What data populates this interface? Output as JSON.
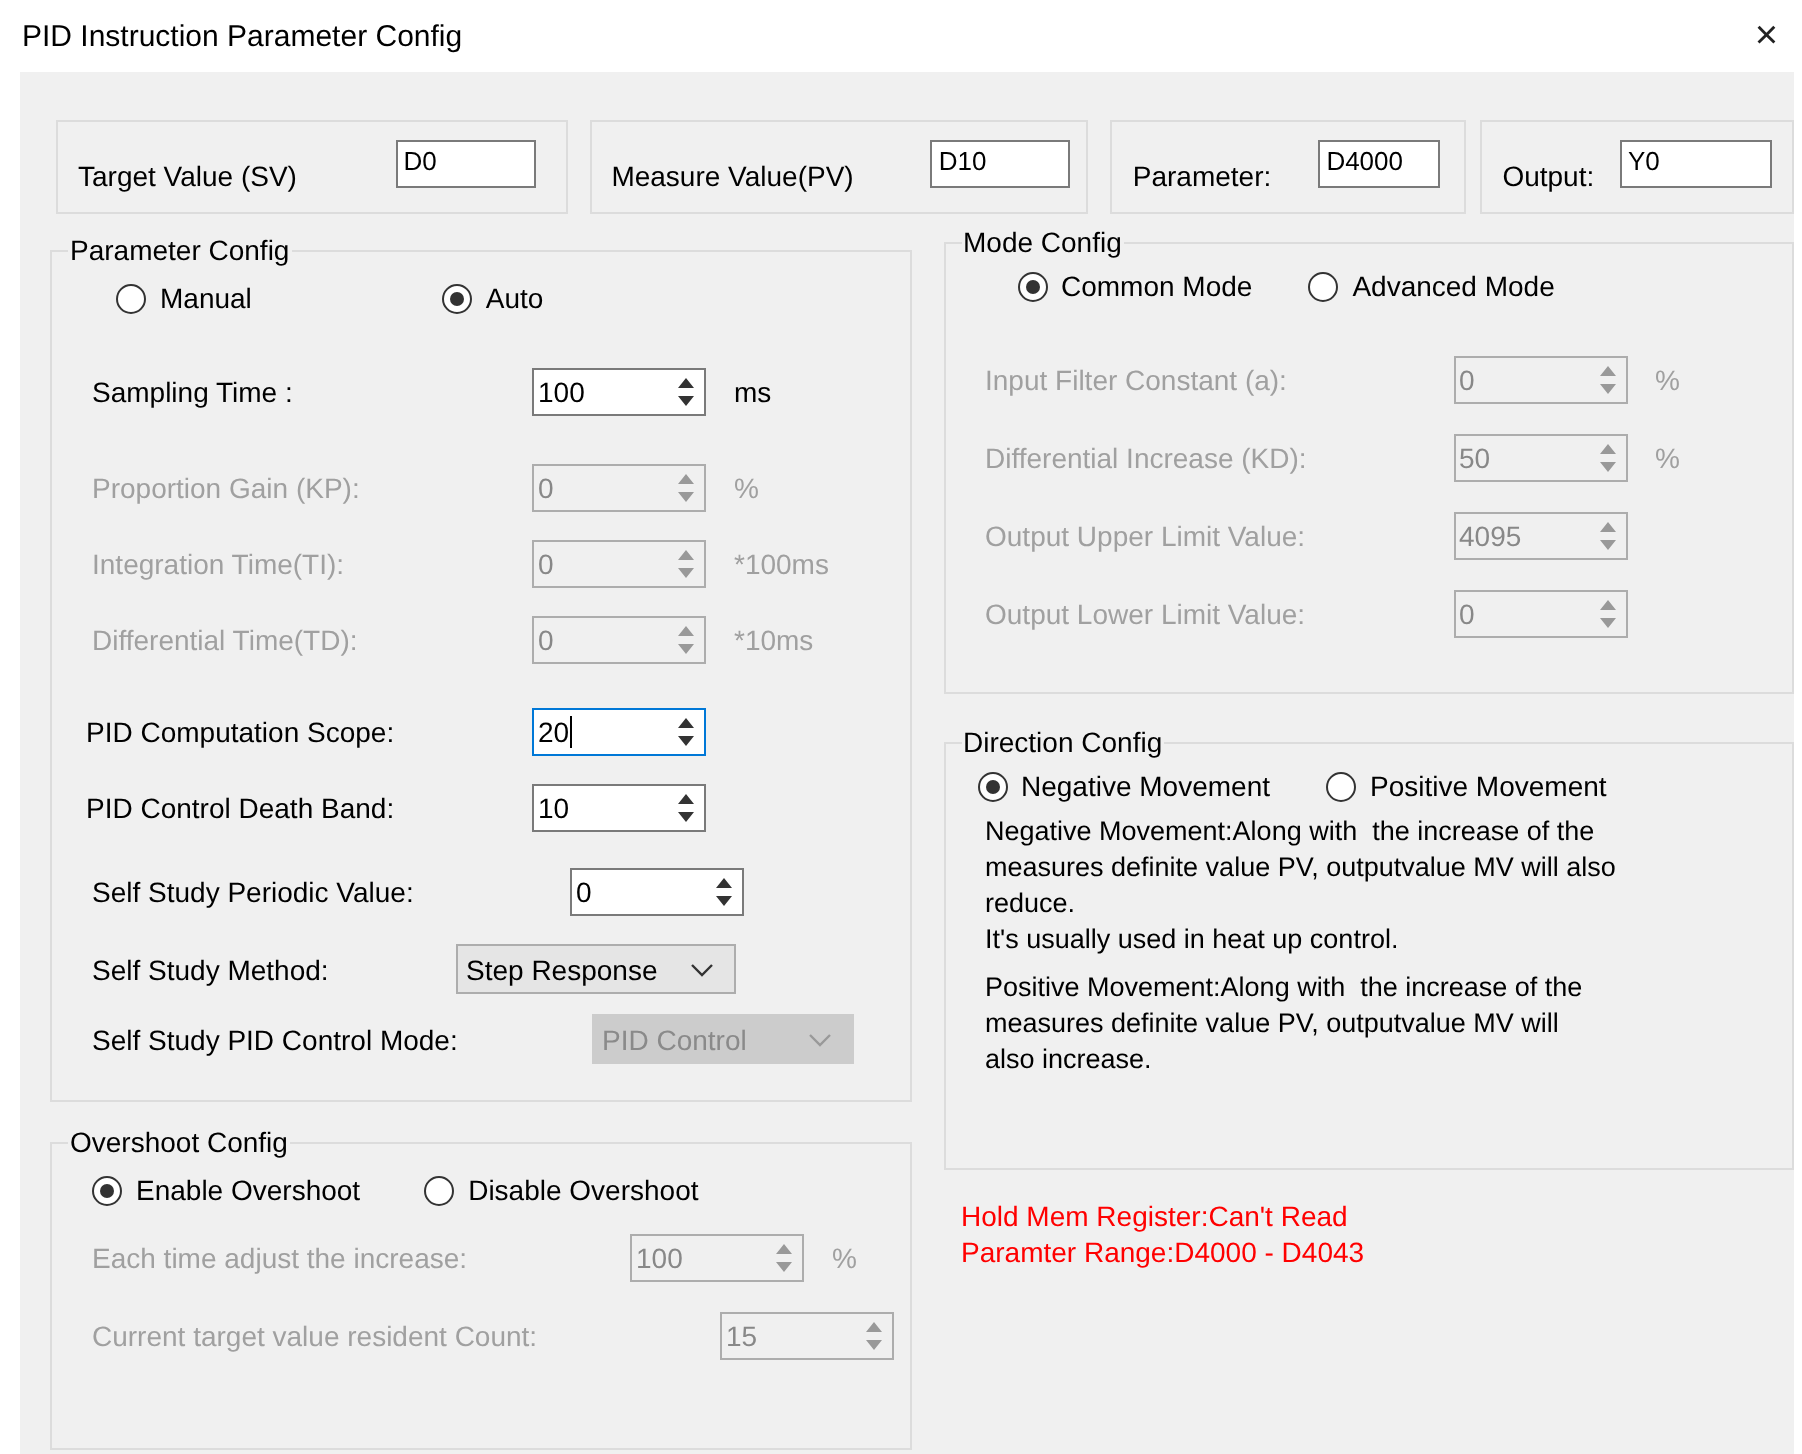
{
  "window": {
    "title": "PID Instruction Parameter Config",
    "close": "×"
  },
  "top_fields": [
    {
      "label": "Target Value (SV)",
      "value": "D0"
    },
    {
      "label": "Measure Value(PV)",
      "value": "D10"
    },
    {
      "label": "Parameter:",
      "value": "D4000"
    },
    {
      "label": "Output:",
      "value": "Y0"
    }
  ],
  "parameter_config": {
    "title": "Parameter Config",
    "modes": [
      {
        "label": "Manual",
        "selected": false
      },
      {
        "label": "Auto",
        "selected": true
      }
    ],
    "main_rows": [
      {
        "label": "Sampling Time :",
        "value": "100",
        "unit": "ms",
        "disabled": false
      }
    ],
    "pid_rows": [
      {
        "label": "Proportion Gain (KP):",
        "value": "0",
        "unit": "%",
        "disabled": true
      },
      {
        "label": "Integration Time(TI):",
        "value": "0",
        "unit": "*100ms",
        "disabled": true
      },
      {
        "label": "Differential Time(TD):",
        "value": "0",
        "unit": "*10ms",
        "disabled": true
      }
    ],
    "scope_rows": [
      {
        "label": "PID Computation Scope:",
        "value": "20",
        "disabled": false,
        "focused": true
      },
      {
        "label": "PID Control Death Band:",
        "value": "10",
        "disabled": false,
        "focused": false
      }
    ],
    "self_study": [
      {
        "kind": "spin",
        "label": "Self Study Periodic Value:",
        "value": "0",
        "disabled": false
      },
      {
        "kind": "select",
        "label": "Self Study Method:",
        "value": "Step Response",
        "disabled": false
      },
      {
        "kind": "select",
        "label": "Self Study PID Control Mode:",
        "value": "PID Control",
        "disabled": true
      }
    ]
  },
  "overshoot_config": {
    "title": "Overshoot Config",
    "options": [
      {
        "label": "Enable Overshoot",
        "selected": true
      },
      {
        "label": "Disable Overshoot",
        "selected": false
      }
    ],
    "rows": [
      {
        "label": "Each time adjust the increase:",
        "value": "100",
        "unit": "%",
        "disabled": true
      },
      {
        "label": "Current target value resident Count:",
        "value": "15",
        "disabled": true
      }
    ]
  },
  "mode_config": {
    "title": "Mode Config",
    "modes": [
      {
        "label": "Common Mode",
        "selected": true
      },
      {
        "label": "Advanced Mode",
        "selected": false
      }
    ],
    "rows": [
      {
        "label": "Input Filter Constant (a):",
        "value": "0",
        "unit": "%",
        "disabled": true
      },
      {
        "label": "Differential Increase (KD):",
        "value": "50",
        "unit": "%",
        "disabled": true
      },
      {
        "label": "Output Upper Limit Value:",
        "value": "4095",
        "disabled": true
      },
      {
        "label": "Output Lower Limit Value:",
        "value": "0",
        "disabled": true
      }
    ]
  },
  "direction_config": {
    "title": "Direction Config",
    "options": [
      {
        "label": "Negative Movement",
        "selected": true
      },
      {
        "label": "Positive Movement",
        "selected": false
      }
    ],
    "descriptions": [
      "Negative Movement:Along with  the increase of the\nmeasures definite value PV, outputvalue MV will also\nreduce.\nIt's usually used in heat up control.",
      "Positive Movement:Along with  the increase of the\nmeasures definite value PV, outputvalue MV will\nalso increase."
    ]
  },
  "messages": [
    "Hold Mem Register:Can't Read",
    "Paramter Range:D4000 - D4043"
  ]
}
